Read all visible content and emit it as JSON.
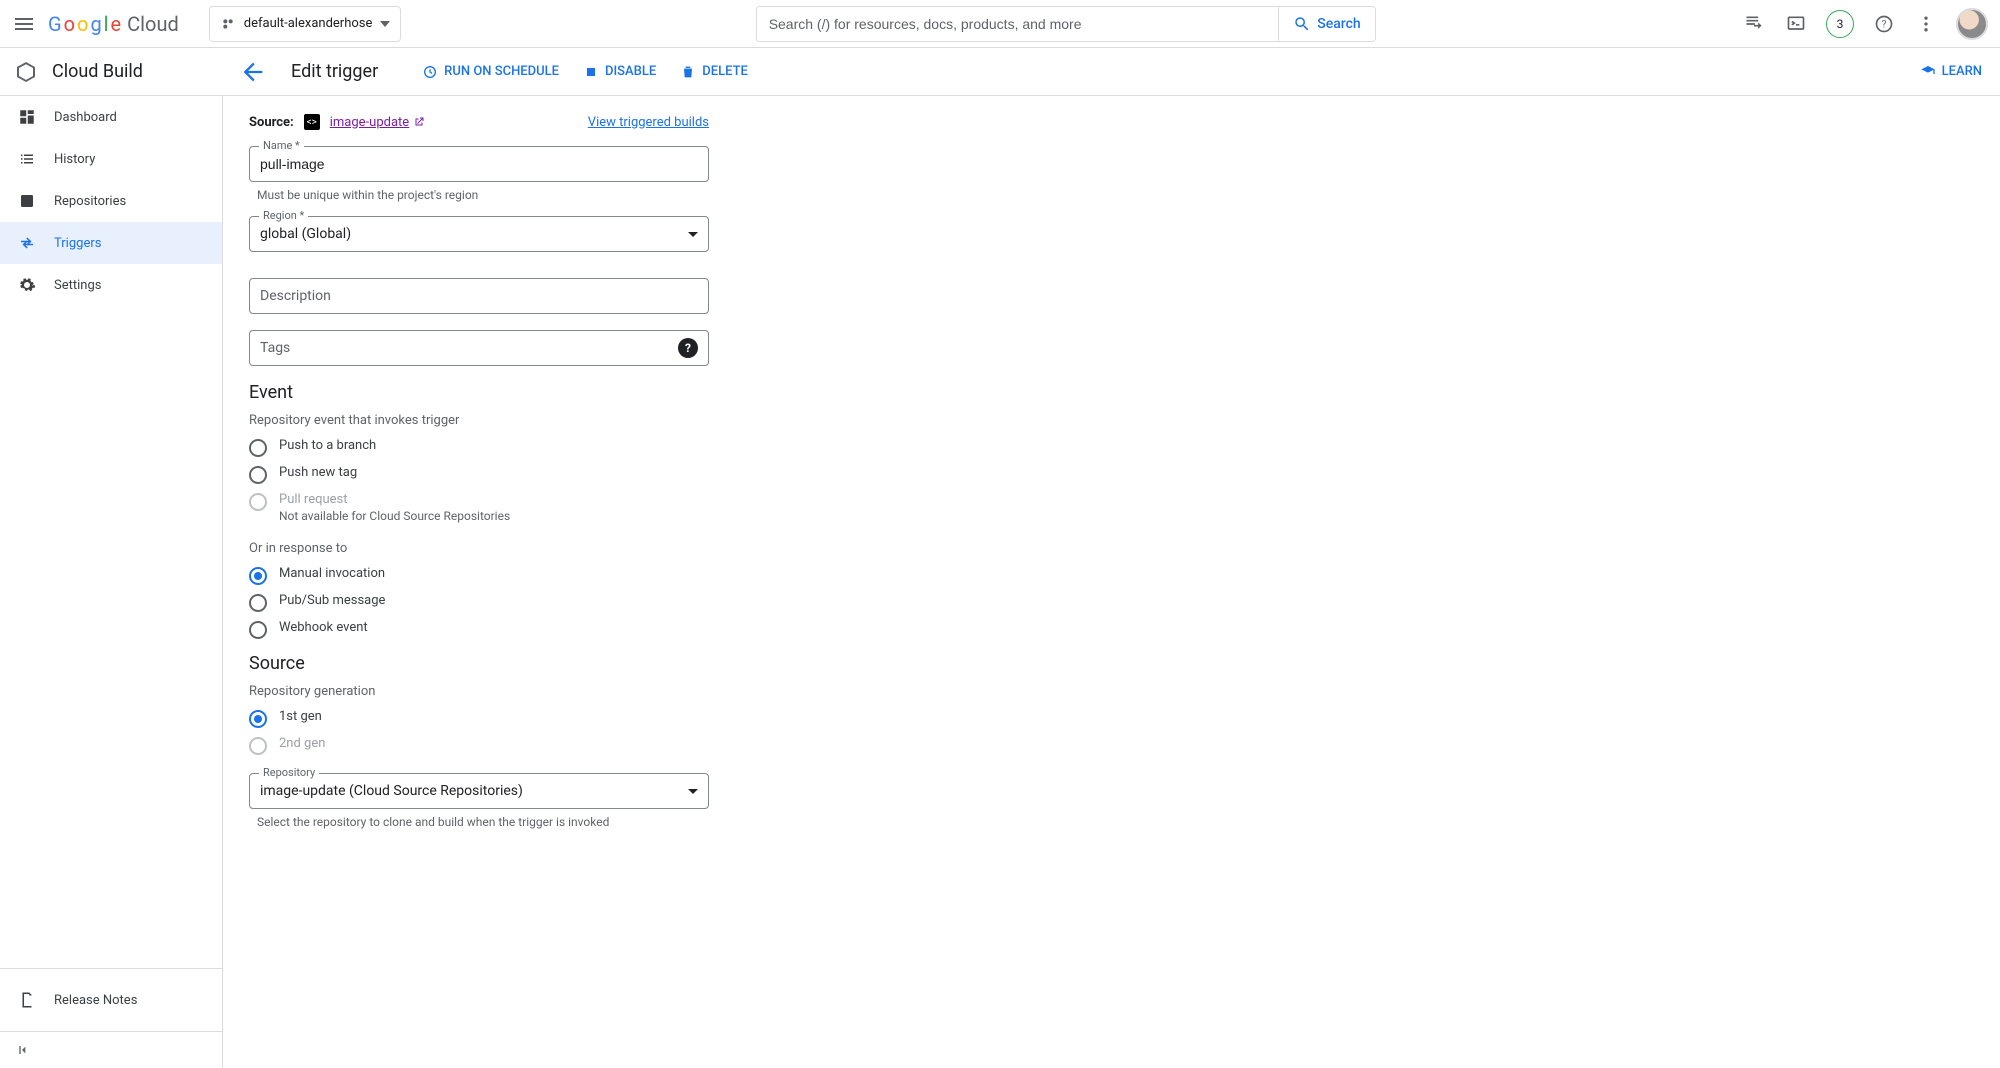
{
  "topbar": {
    "logo_cloud": "Cloud",
    "project": "default-alexanderhose",
    "search_placeholder": "Search (/) for resources, docs, products, and more",
    "search_button": "Search",
    "badge_count": "3"
  },
  "service": {
    "name": "Cloud Build",
    "page_title": "Edit trigger",
    "actions": {
      "run": "RUN ON SCHEDULE",
      "disable": "DISABLE",
      "delete": "DELETE",
      "learn": "LEARN"
    }
  },
  "nav": {
    "items": [
      {
        "label": "Dashboard"
      },
      {
        "label": "History"
      },
      {
        "label": "Repositories"
      },
      {
        "label": "Triggers"
      },
      {
        "label": "Settings"
      }
    ],
    "release_notes": "Release Notes"
  },
  "form": {
    "source_label": "Source:",
    "source_link": "image-update",
    "view_builds": "View triggered builds",
    "name_label": "Name *",
    "name_value": "pull-image",
    "name_helper": "Must be unique within the project's region",
    "region_label": "Region *",
    "region_value": "global (Global)",
    "description_placeholder": "Description",
    "tags_placeholder": "Tags",
    "event": {
      "heading": "Event",
      "subhead1": "Repository event that invokes trigger",
      "opts1": [
        {
          "label": "Push to a branch"
        },
        {
          "label": "Push new tag"
        },
        {
          "label": "Pull request",
          "sub": "Not available for Cloud Source Repositories",
          "disabled": true
        }
      ],
      "subhead2": "Or in response to",
      "opts2": [
        {
          "label": "Manual invocation",
          "checked": true
        },
        {
          "label": "Pub/Sub message"
        },
        {
          "label": "Webhook event"
        }
      ]
    },
    "source_section": {
      "heading": "Source",
      "subhead": "Repository generation",
      "gens": [
        {
          "label": "1st gen",
          "checked": true
        },
        {
          "label": "2nd gen",
          "disabled": true
        }
      ],
      "repo_label": "Repository",
      "repo_value": "image-update (Cloud Source Repositories)",
      "repo_helper": "Select the repository to clone and build when the trigger is invoked"
    }
  }
}
